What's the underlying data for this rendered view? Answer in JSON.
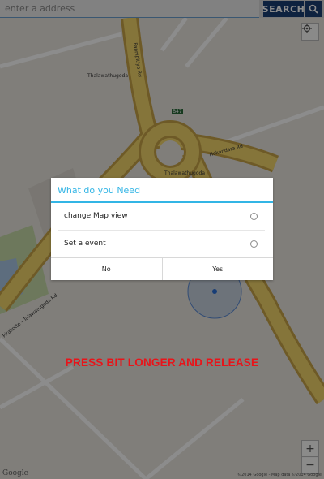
{
  "search": {
    "placeholder": "enter a address",
    "button_label": "SEARCH",
    "icon": "search-icon"
  },
  "map": {
    "labels": {
      "road_1": "Thalawathugoda",
      "road_2": "Pannipitiya Rd",
      "road_3": "Hokandara Rd",
      "place": "Thalawathugoda",
      "road_4": "Pitakotte - Talawatugoda Rd",
      "marker": "B47"
    },
    "zoom_in": "+",
    "zoom_out": "−",
    "logo": "Google",
    "credit": "©2014 Google - Map data ©2014 Google",
    "locate_icon": "crosshair-icon"
  },
  "dialog": {
    "title": "What do you Need",
    "options": [
      {
        "label": "change Map view",
        "selected": false
      },
      {
        "label": "Set a event",
        "selected": false
      }
    ],
    "negative_label": "No",
    "positive_label": "Yes",
    "accent_color": "#33b5e5"
  },
  "hint": {
    "text": "PRESS BIT LONGER AND RELEASE",
    "color": "#e8141a"
  }
}
